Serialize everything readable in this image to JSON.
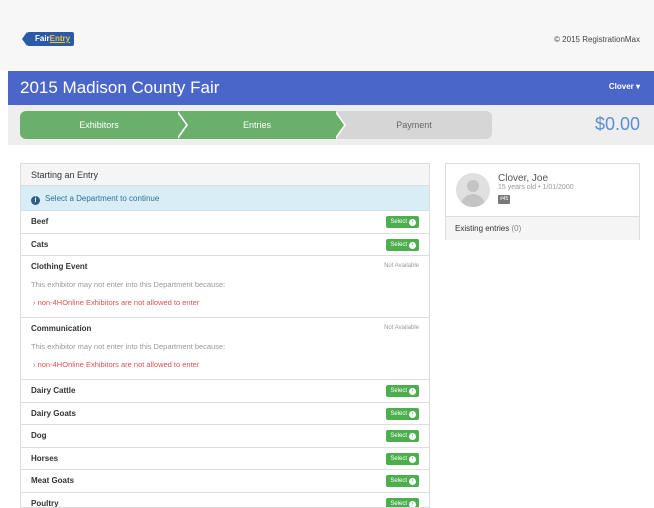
{
  "app": {
    "logo": {
      "part1": "Fair",
      "part2": "Entry"
    },
    "copyright": "© 2015 RegistrationMax"
  },
  "header": {
    "title": "2015 Madison County Fair",
    "user_menu": "Clover ▾"
  },
  "steps": [
    {
      "label": "Exhibitors",
      "state": "complete"
    },
    {
      "label": "Entries",
      "state": "complete"
    },
    {
      "label": "Payment",
      "state": "pending"
    }
  ],
  "cart_total": "$0.00",
  "entry_panel": {
    "title": "Starting an Entry",
    "notice": "Select a Department to continue",
    "select_label": "Select",
    "not_available_label": "Not Available",
    "blocked_reason": "This exhibitor may not enter into this Department because:",
    "departments": [
      {
        "name": "Beef",
        "available": true
      },
      {
        "name": "Cats",
        "available": true
      },
      {
        "name": "Clothing Event",
        "available": false,
        "rule": "non-4HOnline Exhibitors are not allowed to enter"
      },
      {
        "name": "Communication",
        "available": false,
        "rule": "non-4HOnline Exhibitors are not allowed to enter"
      },
      {
        "name": "Dairy Cattle",
        "available": true
      },
      {
        "name": "Dairy Goats",
        "available": true
      },
      {
        "name": "Dog",
        "available": true
      },
      {
        "name": "Horses",
        "available": true
      },
      {
        "name": "Meat Goats",
        "available": true
      },
      {
        "name": "Poultry",
        "available": true
      }
    ]
  },
  "exhibitor": {
    "name": "Clover, Joe",
    "details": "15 years old • 1/01/2000",
    "badge": "#45",
    "existing_label": "Existing entries",
    "existing_count": "(0)"
  },
  "colors": {
    "brand_blue": "#4a66c8",
    "step_green": "#6ab06a",
    "select_green": "#4cae4c",
    "error_red": "#d9534f"
  }
}
